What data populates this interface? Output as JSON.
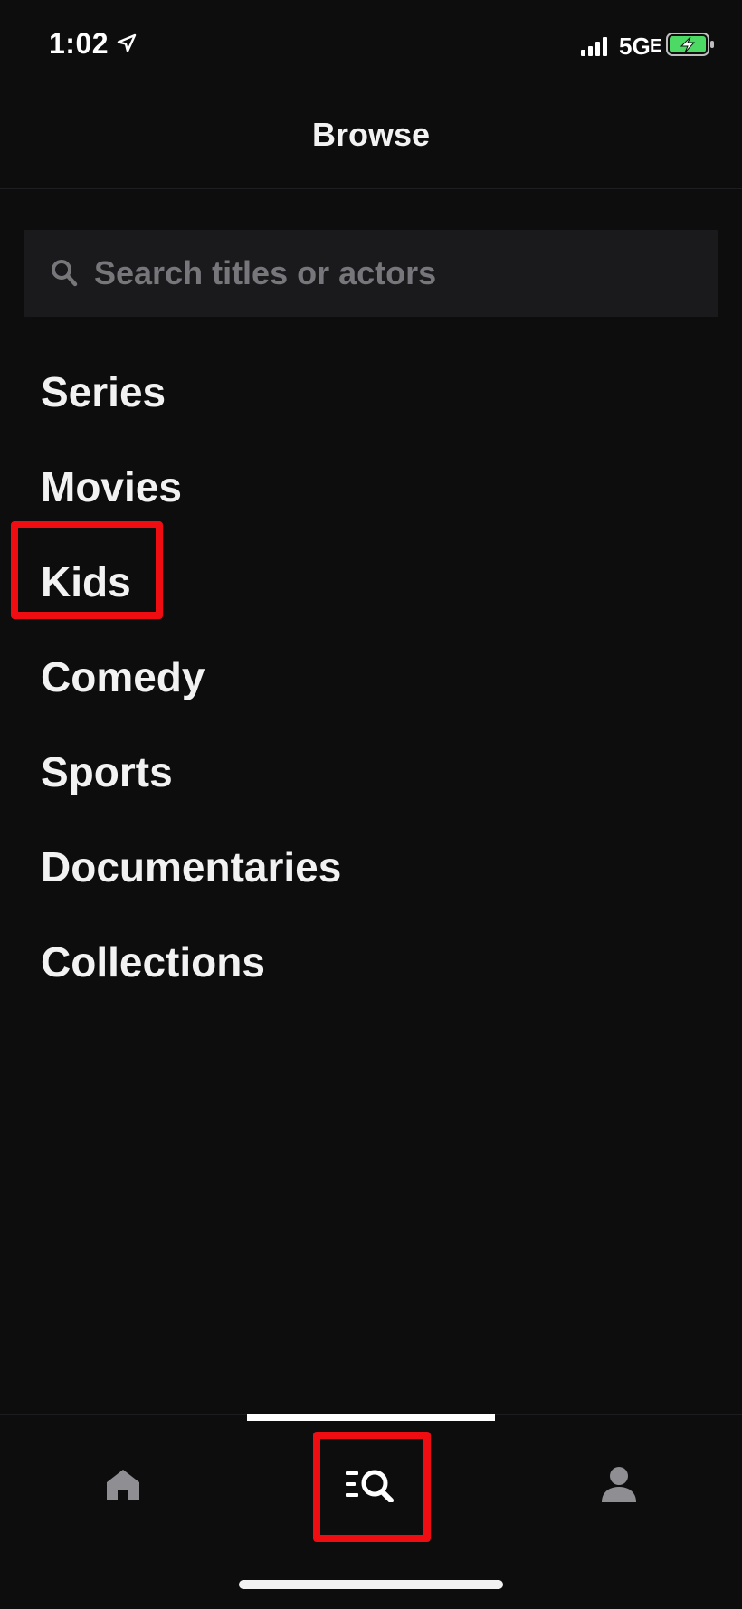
{
  "status_bar": {
    "time": "1:02",
    "network": "5G",
    "network_suffix": "E"
  },
  "header": {
    "title": "Browse"
  },
  "search": {
    "placeholder": "Search titles or actors",
    "value": ""
  },
  "categories": [
    {
      "label": "Series"
    },
    {
      "label": "Movies"
    },
    {
      "label": "Kids"
    },
    {
      "label": "Comedy"
    },
    {
      "label": "Sports"
    },
    {
      "label": "Documentaries"
    },
    {
      "label": "Collections"
    }
  ],
  "tab_bar": {
    "tabs": [
      {
        "name": "home",
        "icon": "home-icon"
      },
      {
        "name": "browse",
        "icon": "browse-search-icon",
        "active": true
      },
      {
        "name": "profile",
        "icon": "profile-icon"
      }
    ]
  },
  "colors": {
    "background": "#0d0d0e",
    "text": "#f2f2f2",
    "placeholder": "#77777b",
    "search_bg": "#1a1a1c",
    "highlight": "#f00d12",
    "inactive_icon": "#8e8e93",
    "battery_green": "#4cd964"
  }
}
